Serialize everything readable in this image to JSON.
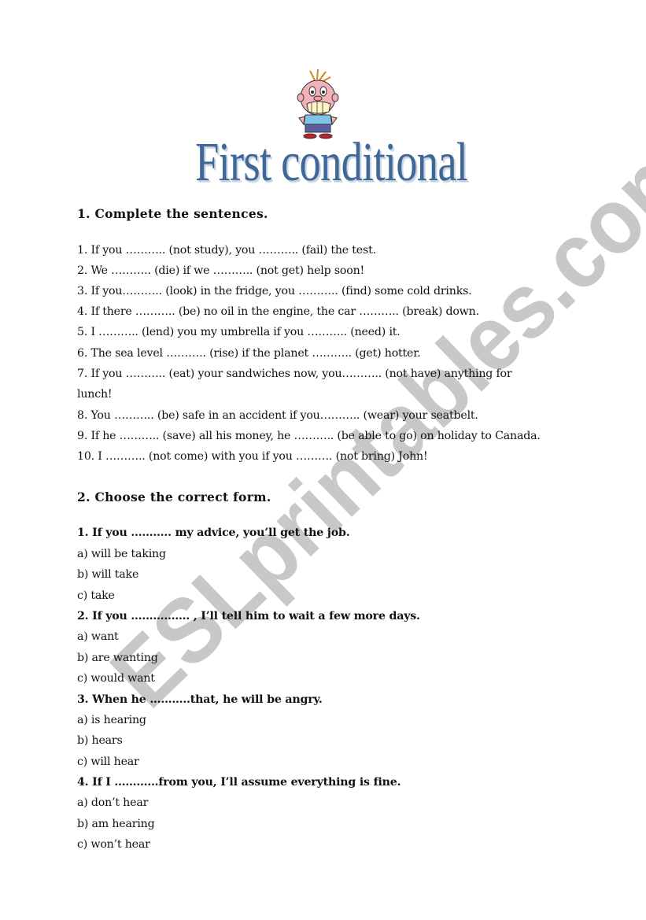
{
  "title": "First conditional",
  "illustration": "cartoon-boy-gritting-teeth",
  "watermark": "ESLprintables.com",
  "section1": {
    "heading": "1. Complete the sentences.",
    "items": [
      "1. If you ……….. (not study), you ………..  (fail) the test.",
      "2. We  ………..  (die) if we ………..  (not get) help soon!",
      "3. If you………..    (look) in the fridge, you ………..  (find) some cold drinks.",
      "4. If there ………..  (be) no oil in the engine, the car ………..   (break) down.",
      "5. I ………..  (lend) you my umbrella if you ………..  (need) it.",
      "6. The sea level ………..   (rise) if the planet  ……….. (get) hotter.",
      "7. If you ………..  (eat) your sandwiches now, you………..   (not have) anything for",
      "lunch!",
      "8. You ………..  (be) safe in an accident if you………..   (wear) your seatbelt.",
      "9. If he ………..  (save) all his money, he ………..  (be able to go) on holiday to Canada.",
      "10. I ………..  (not come) with you if you ……….  (not bring) John!"
    ]
  },
  "section2": {
    "heading": "2. Choose the correct form.",
    "questions": [
      {
        "q": "1. If you ……….. my advice, you’ll get the job.",
        "options": [
          "a) will be taking",
          "b) will take",
          "c) take"
        ]
      },
      {
        "q": "2. If you ……………. , I’ll tell him to wait a few more days.",
        "options": [
          "a) want",
          "b) are wanting",
          "c) would want"
        ]
      },
      {
        "q": "3. When he ………..that, he will be angry.",
        "options": [
          "a) is hearing",
          "b) hears",
          "c) will hear"
        ]
      },
      {
        "q": "4. If I …………from you, I’ll assume everything is fine.",
        "options": [
          "a) don’t hear",
          "b) am hearing",
          "c) won’t hear"
        ]
      }
    ]
  },
  "colors": {
    "title": "#3f6797",
    "watermark": "#cccccc",
    "text": "#111111"
  }
}
